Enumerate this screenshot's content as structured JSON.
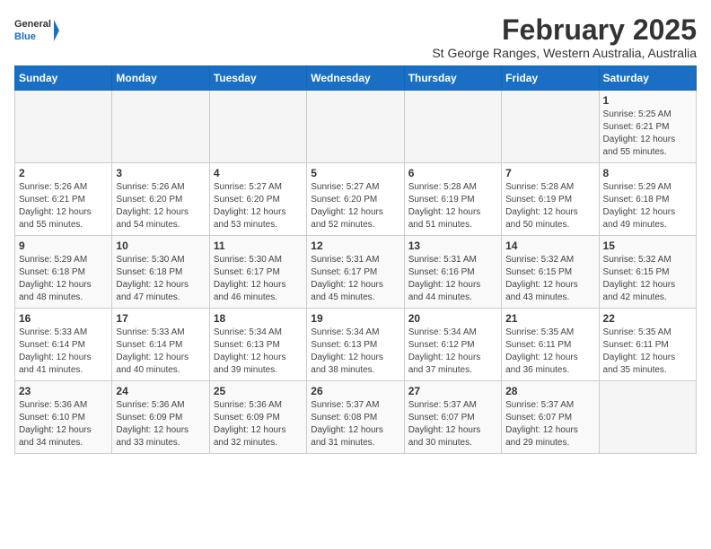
{
  "logo": {
    "general": "General",
    "blue": "Blue"
  },
  "title": "February 2025",
  "subtitle": "St George Ranges, Western Australia, Australia",
  "weekdays": [
    "Sunday",
    "Monday",
    "Tuesday",
    "Wednesday",
    "Thursday",
    "Friday",
    "Saturday"
  ],
  "weeks": [
    [
      {
        "day": "",
        "info": ""
      },
      {
        "day": "",
        "info": ""
      },
      {
        "day": "",
        "info": ""
      },
      {
        "day": "",
        "info": ""
      },
      {
        "day": "",
        "info": ""
      },
      {
        "day": "",
        "info": ""
      },
      {
        "day": "1",
        "info": "Sunrise: 5:25 AM\nSunset: 6:21 PM\nDaylight: 12 hours\nand 55 minutes."
      }
    ],
    [
      {
        "day": "2",
        "info": "Sunrise: 5:26 AM\nSunset: 6:21 PM\nDaylight: 12 hours\nand 55 minutes."
      },
      {
        "day": "3",
        "info": "Sunrise: 5:26 AM\nSunset: 6:20 PM\nDaylight: 12 hours\nand 54 minutes."
      },
      {
        "day": "4",
        "info": "Sunrise: 5:27 AM\nSunset: 6:20 PM\nDaylight: 12 hours\nand 53 minutes."
      },
      {
        "day": "5",
        "info": "Sunrise: 5:27 AM\nSunset: 6:20 PM\nDaylight: 12 hours\nand 52 minutes."
      },
      {
        "day": "6",
        "info": "Sunrise: 5:28 AM\nSunset: 6:19 PM\nDaylight: 12 hours\nand 51 minutes."
      },
      {
        "day": "7",
        "info": "Sunrise: 5:28 AM\nSunset: 6:19 PM\nDaylight: 12 hours\nand 50 minutes."
      },
      {
        "day": "8",
        "info": "Sunrise: 5:29 AM\nSunset: 6:18 PM\nDaylight: 12 hours\nand 49 minutes."
      }
    ],
    [
      {
        "day": "9",
        "info": "Sunrise: 5:29 AM\nSunset: 6:18 PM\nDaylight: 12 hours\nand 48 minutes."
      },
      {
        "day": "10",
        "info": "Sunrise: 5:30 AM\nSunset: 6:18 PM\nDaylight: 12 hours\nand 47 minutes."
      },
      {
        "day": "11",
        "info": "Sunrise: 5:30 AM\nSunset: 6:17 PM\nDaylight: 12 hours\nand 46 minutes."
      },
      {
        "day": "12",
        "info": "Sunrise: 5:31 AM\nSunset: 6:17 PM\nDaylight: 12 hours\nand 45 minutes."
      },
      {
        "day": "13",
        "info": "Sunrise: 5:31 AM\nSunset: 6:16 PM\nDaylight: 12 hours\nand 44 minutes."
      },
      {
        "day": "14",
        "info": "Sunrise: 5:32 AM\nSunset: 6:15 PM\nDaylight: 12 hours\nand 43 minutes."
      },
      {
        "day": "15",
        "info": "Sunrise: 5:32 AM\nSunset: 6:15 PM\nDaylight: 12 hours\nand 42 minutes."
      }
    ],
    [
      {
        "day": "16",
        "info": "Sunrise: 5:33 AM\nSunset: 6:14 PM\nDaylight: 12 hours\nand 41 minutes."
      },
      {
        "day": "17",
        "info": "Sunrise: 5:33 AM\nSunset: 6:14 PM\nDaylight: 12 hours\nand 40 minutes."
      },
      {
        "day": "18",
        "info": "Sunrise: 5:34 AM\nSunset: 6:13 PM\nDaylight: 12 hours\nand 39 minutes."
      },
      {
        "day": "19",
        "info": "Sunrise: 5:34 AM\nSunset: 6:13 PM\nDaylight: 12 hours\nand 38 minutes."
      },
      {
        "day": "20",
        "info": "Sunrise: 5:34 AM\nSunset: 6:12 PM\nDaylight: 12 hours\nand 37 minutes."
      },
      {
        "day": "21",
        "info": "Sunrise: 5:35 AM\nSunset: 6:11 PM\nDaylight: 12 hours\nand 36 minutes."
      },
      {
        "day": "22",
        "info": "Sunrise: 5:35 AM\nSunset: 6:11 PM\nDaylight: 12 hours\nand 35 minutes."
      }
    ],
    [
      {
        "day": "23",
        "info": "Sunrise: 5:36 AM\nSunset: 6:10 PM\nDaylight: 12 hours\nand 34 minutes."
      },
      {
        "day": "24",
        "info": "Sunrise: 5:36 AM\nSunset: 6:09 PM\nDaylight: 12 hours\nand 33 minutes."
      },
      {
        "day": "25",
        "info": "Sunrise: 5:36 AM\nSunset: 6:09 PM\nDaylight: 12 hours\nand 32 minutes."
      },
      {
        "day": "26",
        "info": "Sunrise: 5:37 AM\nSunset: 6:08 PM\nDaylight: 12 hours\nand 31 minutes."
      },
      {
        "day": "27",
        "info": "Sunrise: 5:37 AM\nSunset: 6:07 PM\nDaylight: 12 hours\nand 30 minutes."
      },
      {
        "day": "28",
        "info": "Sunrise: 5:37 AM\nSunset: 6:07 PM\nDaylight: 12 hours\nand 29 minutes."
      },
      {
        "day": "",
        "info": ""
      }
    ]
  ],
  "colors": {
    "header_bg": "#1a6fc4",
    "header_text": "#ffffff",
    "accent": "#1a6fc4"
  }
}
